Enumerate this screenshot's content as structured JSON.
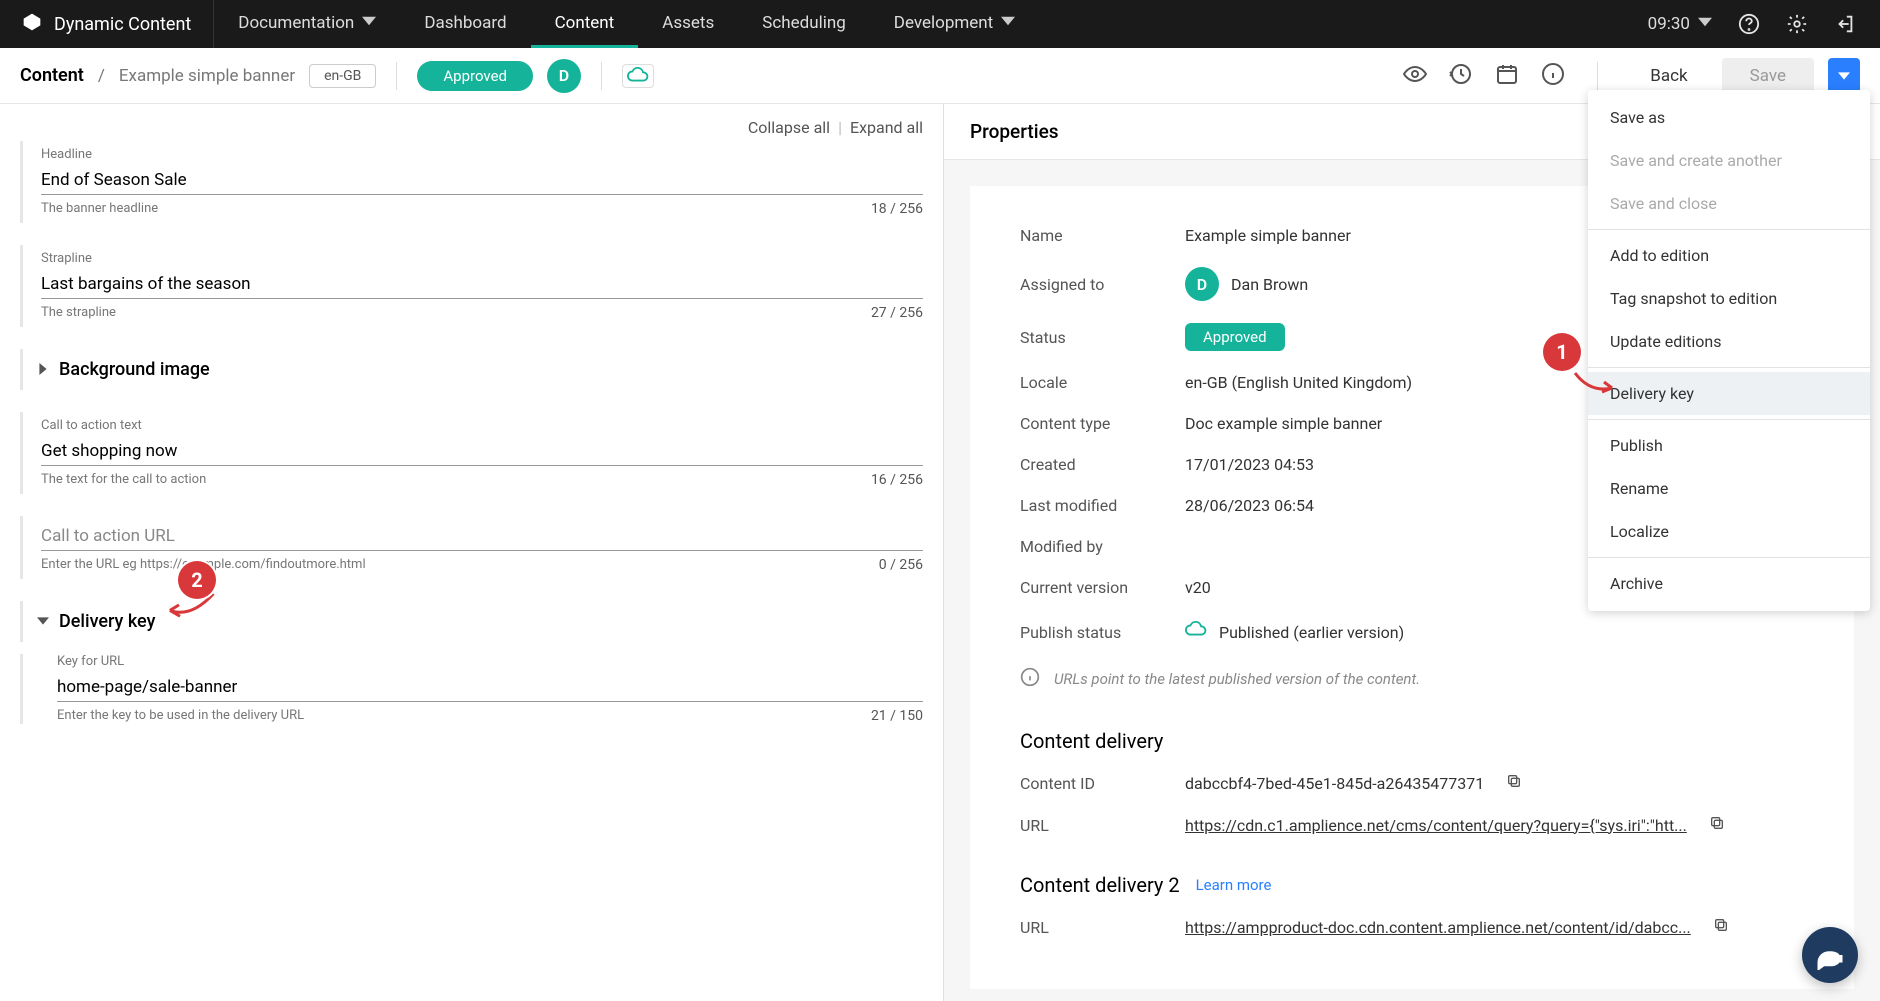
{
  "topbar": {
    "brand": "Dynamic Content",
    "nav": {
      "documentation": "Documentation",
      "dashboard": "Dashboard",
      "content": "Content",
      "assets": "Assets",
      "scheduling": "Scheduling",
      "development": "Development"
    },
    "time": "09:30"
  },
  "subbar": {
    "crumb_root": "Content",
    "crumb_name": "Example simple banner",
    "locale": "en-GB",
    "status": "Approved",
    "avatar_initial": "D",
    "back": "Back",
    "save": "Save"
  },
  "save_menu": {
    "save_as": "Save as",
    "save_create_another": "Save and create another",
    "save_close": "Save and close",
    "add_to_edition": "Add to edition",
    "tag_snapshot": "Tag snapshot to edition",
    "update_editions": "Update editions",
    "delivery_key": "Delivery key",
    "publish": "Publish",
    "rename": "Rename",
    "localize": "Localize",
    "archive": "Archive"
  },
  "callouts": {
    "c1": "1",
    "c2": "2"
  },
  "form": {
    "toolbar": {
      "collapse": "Collapse all",
      "sep": "|",
      "expand": "Expand all"
    },
    "headline": {
      "label": "Headline",
      "value": "End of Season Sale",
      "helper": "The banner headline",
      "count": "18 / 256"
    },
    "strapline": {
      "label": "Strapline",
      "value": "Last bargains of the season",
      "helper": "The strapline",
      "count": "27 / 256"
    },
    "bgimage": {
      "title": "Background image"
    },
    "cta_text": {
      "label": "Call to action text",
      "value": "Get shopping now",
      "helper": "The text for the call to action",
      "count": "16 / 256"
    },
    "cta_url": {
      "label": "",
      "placeholder": "Call to action URL",
      "helper": "Enter the URL eg https://example.com/findoutmore.html",
      "count": "0 / 256"
    },
    "delivery_key_section": {
      "title": "Delivery key",
      "field_label": "Key for URL",
      "value": "home-page/sale-banner",
      "helper": "Enter the key to be used in the delivery URL",
      "count": "21 / 150"
    }
  },
  "properties": {
    "header": "Properties",
    "name_l": "Name",
    "name_v": "Example simple banner",
    "assigned_l": "Assigned to",
    "assigned_initial": "D",
    "assigned_v": "Dan Brown",
    "status_l": "Status",
    "status_v": "Approved",
    "locale_l": "Locale",
    "locale_v": "en-GB (English United Kingdom)",
    "type_l": "Content type",
    "type_v": "Doc example simple banner",
    "created_l": "Created",
    "created_v": "17/01/2023 04:53",
    "modified_l": "Last modified",
    "modified_v": "28/06/2023 06:54",
    "modifiedby_l": "Modified by",
    "modifiedby_v": "",
    "version_l": "Current version",
    "version_v": "v20",
    "pubstatus_l": "Publish status",
    "pubstatus_v": "Published (earlier version)",
    "info": "URLs point to the latest published version of the content.",
    "cd1_title": "Content delivery",
    "cid_l": "Content ID",
    "cid_v": "dabccbf4-7bed-45e1-845d-a26435477371",
    "url_l": "URL",
    "url_v": "https://cdn.c1.amplience.net/cms/content/query?query={\"sys.iri\":\"htt...",
    "cd2_title": "Content delivery 2",
    "cd2_learn": "Learn more",
    "url2_l": "URL",
    "url2_v": "https://ampproduct-doc.cdn.content.amplience.net/content/id/dabcc..."
  }
}
